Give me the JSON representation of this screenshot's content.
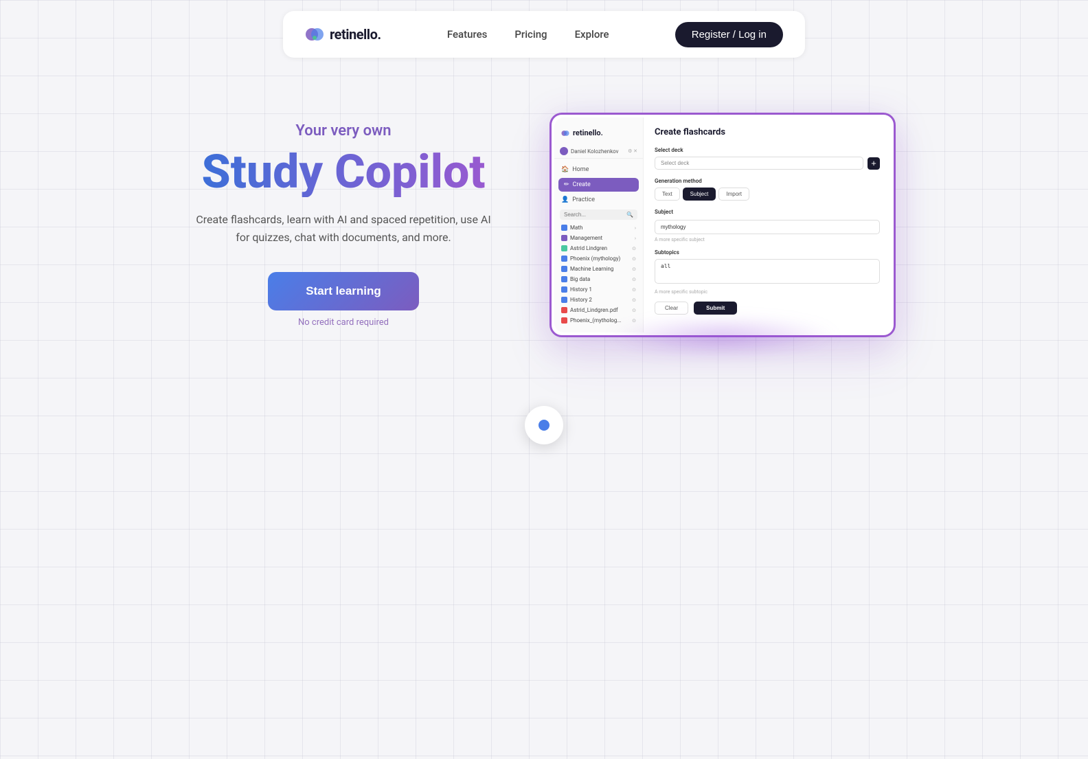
{
  "nav": {
    "logo_text": "retinello.",
    "links": [
      "Features",
      "Pricing",
      "Explore"
    ],
    "register_label": "Register / Log in"
  },
  "hero": {
    "tagline": "Your very own",
    "title": "Study Copilot",
    "description": "Create flashcards, learn with AI and spaced\nrepetition, use AI for quizzes, chat with documents,\nand more.",
    "cta_label": "Start learning",
    "no_credit": "No credit card required"
  },
  "app": {
    "logo": "retinello.",
    "user": "Daniel Kolozhenkov",
    "nav": {
      "home": "Home",
      "create": "Create",
      "practice": "Practice"
    },
    "search_placeholder": "Search...",
    "deck_list": [
      {
        "name": "Math",
        "color": "#4a7ee8",
        "has_arrow": true
      },
      {
        "name": "Management",
        "color": "#7c5cbf",
        "has_arrow": true
      },
      {
        "name": "Astrid Lindgren",
        "color": "#4ac8a0",
        "has_arrow": false
      },
      {
        "name": "Phoenix (mythology)",
        "color": "#4a7ee8",
        "has_arrow": false
      },
      {
        "name": "Machine Learning",
        "color": "#4a7ee8",
        "has_arrow": false
      },
      {
        "name": "Big data",
        "color": "#4a7ee8",
        "has_arrow": false
      },
      {
        "name": "History 1",
        "color": "#4a7ee8",
        "has_arrow": false
      },
      {
        "name": "History 2",
        "color": "#4a7ee8",
        "has_arrow": false
      },
      {
        "name": "Astrid_Lindgren.pdf",
        "color": "#e84a4a",
        "has_arrow": false
      },
      {
        "name": "Phoenix_(mytholog...",
        "color": "#e84a4a",
        "has_arrow": false
      }
    ],
    "panel": {
      "title": "Create flashcards",
      "select_deck_label": "Select deck",
      "select_deck_placeholder": "Select deck",
      "generation_method_label": "Generation method",
      "methods": [
        "Text",
        "Subject",
        "Import"
      ],
      "active_method": "Subject",
      "subject_label": "Subject",
      "subject_value": "mythology",
      "subject_hint": "A more specific subject",
      "subtopic_label": "Subtopics",
      "subtopic_value": "all",
      "subtopic_hint": "A more specific subtopic",
      "clear_label": "Clear",
      "submit_label": "Submit"
    }
  }
}
